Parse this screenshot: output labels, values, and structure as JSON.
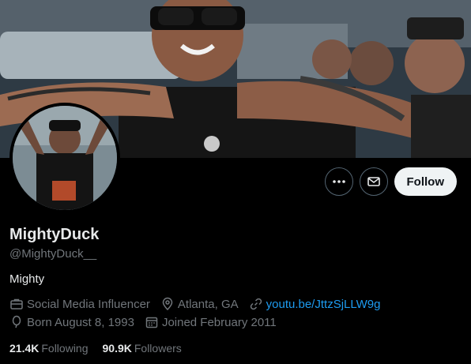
{
  "profile": {
    "display_name": "MightyDuck",
    "handle": "@MightyDuck__",
    "bio": "Mighty",
    "category": "Social Media Influencer",
    "location": "Atlanta, GA",
    "website": "youtu.be/JttzSjLLW9g",
    "birthday": "Born August 8, 1993",
    "joined": "Joined February 2011"
  },
  "stats": {
    "following_count": "21.4K",
    "following_label": "Following",
    "followers_count": "90.9K",
    "followers_label": "Followers"
  },
  "actions": {
    "more_icon": "more-icon",
    "message_icon": "mail-icon",
    "follow_label": "Follow"
  },
  "colors": {
    "background": "#000000",
    "link": "#1d9bf0",
    "muted": "#71767b",
    "text": "#e7e9ea",
    "follow_bg": "#eff3f4"
  }
}
